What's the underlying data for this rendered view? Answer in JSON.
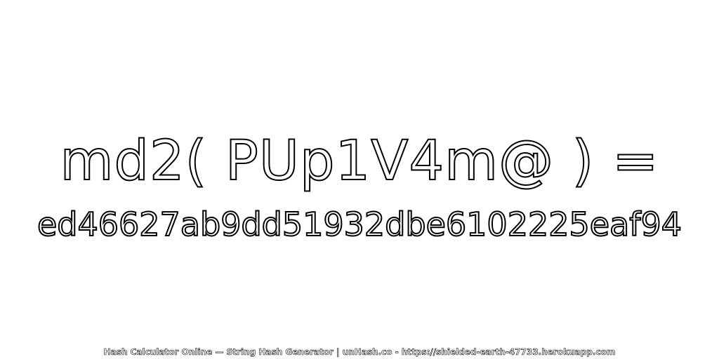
{
  "expression": "md2( PUp1V4m@ ) =",
  "result": "ed46627ab9dd51932dbe6102225eaf94",
  "footer": "Hash Calculator Online — String Hash Generator | unHash.co - https://shielded-earth-47733.herokuapp.com",
  "colors": {
    "background": "#ffffff",
    "text_fill": "#ffffff",
    "text_stroke": "#000000"
  }
}
